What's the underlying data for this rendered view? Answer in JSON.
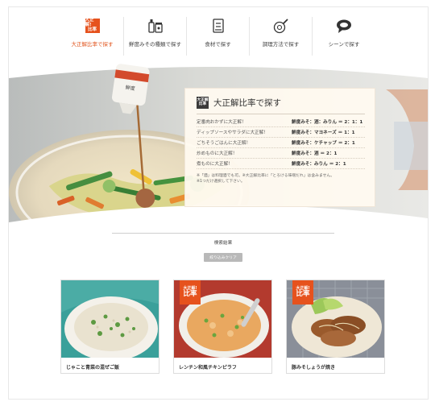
{
  "nav": {
    "items": [
      {
        "badge_top": "大正解!",
        "badge_bottom": "比率",
        "label": "大正解比率で探す",
        "icon": "ratio-badge-icon",
        "active": true
      },
      {
        "label": "鮮度みその種類で探す",
        "icon": "miso-package-icon",
        "active": false
      },
      {
        "label": "食材で探す",
        "icon": "ingredient-card-icon",
        "active": false
      },
      {
        "label": "調理方法で探す",
        "icon": "frying-pan-icon",
        "active": false
      },
      {
        "label": "シーンで探す",
        "icon": "speech-bubble-icon",
        "active": false
      }
    ]
  },
  "hero": {
    "bottle_label": "鮮度",
    "panel": {
      "badge_top": "大正解",
      "badge_bottom": "比率",
      "title": "大正解比率で探す",
      "rows": [
        {
          "label": "定番肉おかずに大正解！",
          "ratio": "鮮度みそ：酒：みりん ＝ 2：1：1"
        },
        {
          "label": "ディップソースやサラダに大正解！",
          "ratio": "鮮度みそ：マヨネーズ ＝ 1：1"
        },
        {
          "label": "ごちそうごはんに大正解！",
          "ratio": "鮮度みそ：ケチャップ ＝ 2：1"
        },
        {
          "label": "炒めものに大正解！",
          "ratio": "鮮度みそ：酒 ＝ 2：1"
        },
        {
          "label": "煮ものに大正解！",
          "ratio": "鮮度みそ：みりん ＝ 2：1"
        }
      ],
      "note_line1": "※「酒」は料理酒でも可。※大正解比率に「とろける味噌だれ」は含みません。",
      "note_line2": "※1つだけ選択して下さい。"
    }
  },
  "results": {
    "label": "検索結果",
    "clear_label": "絞り込みクリア"
  },
  "cards": [
    {
      "title": "じゃこと青菜の混ぜご飯",
      "ribbon": false
    },
    {
      "title": "レンチン和風チキンピラフ",
      "ribbon": true,
      "ribbon_top": "大正解!",
      "ribbon_bottom": "比率"
    },
    {
      "title": "豚みそしょうが焼き",
      "ribbon": true,
      "ribbon_top": "大正解!",
      "ribbon_bottom": "比率"
    }
  ],
  "colors": {
    "accent": "#e6521d",
    "panel_bg": "#fffaf0"
  }
}
